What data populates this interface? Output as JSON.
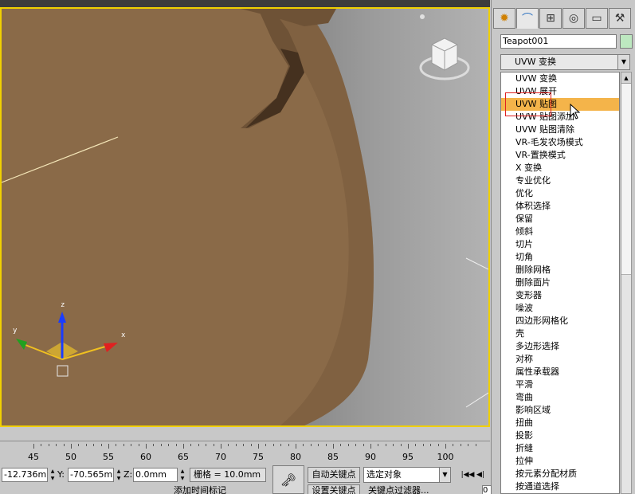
{
  "panel": {
    "tabs": [
      {
        "icon": "create-icon",
        "glyph": "✹"
      },
      {
        "icon": "modify-icon",
        "glyph": "⌒"
      },
      {
        "icon": "hierarchy-icon",
        "glyph": "⊞"
      },
      {
        "icon": "motion-icon",
        "glyph": "◎"
      },
      {
        "icon": "display-icon",
        "glyph": "▭"
      },
      {
        "icon": "utilities-icon",
        "glyph": "⚒"
      }
    ],
    "object_name": "Teapot001",
    "object_color": "#bde8c0",
    "modifier_list_selected": "UVW 变换",
    "modifiers": [
      "UVW 变换",
      "UVW 展开",
      "UVW 贴图",
      "UVW 贴图添加",
      "UVW 贴图清除",
      "VR-毛发农场模式",
      "VR-置换模式",
      "X 变换",
      "专业优化",
      "优化",
      "体积选择",
      "保留",
      "倾斜",
      "切片",
      "切角",
      "删除网格",
      "删除面片",
      "变形器",
      "噪波",
      "四边形网格化",
      "壳",
      "多边形选择",
      "对称",
      "属性承载器",
      "平滑",
      "弯曲",
      "影响区域",
      "扭曲",
      "投影",
      "折缝",
      "拉伸",
      "按元素分配材质",
      "按通道选择"
    ],
    "highlighted_index": 2,
    "highlight_color": "#f4b44a"
  },
  "viewport": {
    "border_color": "#f0d000",
    "object_color": "#8a6a48",
    "gizmo_axes": {
      "x": "x",
      "y": "y",
      "z": "z"
    }
  },
  "timeline": {
    "ticks": [
      "45",
      "50",
      "55",
      "60",
      "65",
      "70",
      "75",
      "80",
      "85",
      "90",
      "95",
      "100"
    ]
  },
  "status": {
    "x_value": "-12.736mm",
    "y_label": "Y:",
    "y_value": "-70.565mm",
    "z_label": "Z:",
    "z_value": "0.0mm",
    "grid": "栅格 = 10.0mm",
    "auto_key": "自动关键点",
    "set_key": "设置关键点",
    "selection_filter": "选定对象",
    "key_filters": "关键点过滤器...",
    "add_time_tag": "添加时间标记",
    "frame": "0"
  }
}
